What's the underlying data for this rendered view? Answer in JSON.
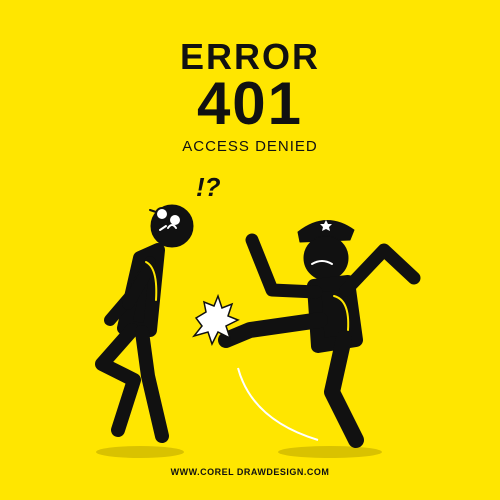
{
  "heading": {
    "error": "ERROR",
    "code": "401",
    "subtitle": "ACCESS DENIED"
  },
  "scene": {
    "surprise_mark": "!?"
  },
  "footer": {
    "credit": "WWW.COREL DRAWDESIGN.COM"
  },
  "colors": {
    "background": "#ffe600",
    "ink": "#111111",
    "shadow": "#d9c200",
    "highlight": "#ffffff"
  }
}
